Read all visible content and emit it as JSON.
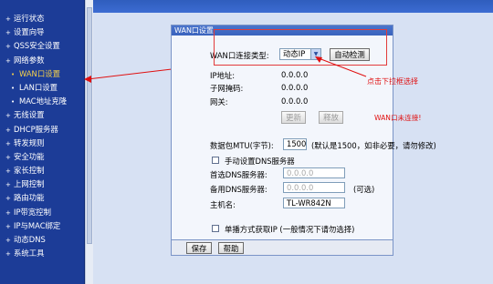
{
  "sidebar": {
    "items": [
      {
        "label": "运行状态",
        "sub": false,
        "active": false
      },
      {
        "label": "设置向导",
        "sub": false,
        "active": false
      },
      {
        "label": "QSS安全设置",
        "sub": false,
        "active": false
      },
      {
        "label": "网络参数",
        "sub": false,
        "active": false
      },
      {
        "label": "WAN口设置",
        "sub": true,
        "active": true
      },
      {
        "label": "LAN口设置",
        "sub": true,
        "active": false
      },
      {
        "label": "MAC地址克隆",
        "sub": true,
        "active": false
      },
      {
        "label": "无线设置",
        "sub": false,
        "active": false
      },
      {
        "label": "DHCP服务器",
        "sub": false,
        "active": false
      },
      {
        "label": "转发规则",
        "sub": false,
        "active": false
      },
      {
        "label": "安全功能",
        "sub": false,
        "active": false
      },
      {
        "label": "家长控制",
        "sub": false,
        "active": false
      },
      {
        "label": "上网控制",
        "sub": false,
        "active": false
      },
      {
        "label": "路由功能",
        "sub": false,
        "active": false
      },
      {
        "label": "IP带宽控制",
        "sub": false,
        "active": false
      },
      {
        "label": "IP与MAC绑定",
        "sub": false,
        "active": false
      },
      {
        "label": "动态DNS",
        "sub": false,
        "active": false
      },
      {
        "label": "系统工具",
        "sub": false,
        "active": false
      }
    ]
  },
  "panel": {
    "title": "WAN口设置",
    "wan_type_label": "WAN口连接类型:",
    "wan_type_value": "动态IP",
    "detect_button": "自动检测",
    "annotation": "点击下拉框选择",
    "ip_label": "IP地址:",
    "ip_value": "0.0.0.0",
    "mask_label": "子网掩码:",
    "mask_value": "0.0.0.0",
    "gateway_label": "网关:",
    "gateway_value": "0.0.0.0",
    "renew_button": "更新",
    "release_button": "释放",
    "wan_status": "WAN口未连接!",
    "mtu_label": "数据包MTU(字节):",
    "mtu_value": "1500",
    "mtu_note": "(默认是1500，如非必要，请勿修改)",
    "manual_dns_label": "手动设置DNS服务器",
    "primary_dns_label": "首选DNS服务器:",
    "primary_dns_value": "0.0.0.0",
    "secondary_dns_label": "备用DNS服务器:",
    "secondary_dns_value": "0.0.0.0",
    "optional": "(可选)",
    "hostname_label": "主机名:",
    "hostname_value": "TL-WR842N",
    "unicast_label": "单播方式获取IP  (一般情况下请勿选择)",
    "save_button": "保存",
    "help_button": "帮助"
  },
  "colors": {
    "sidebar_bg": "#1c3c97",
    "active_item": "#f7d24a",
    "annotation_red": "#e01010"
  }
}
